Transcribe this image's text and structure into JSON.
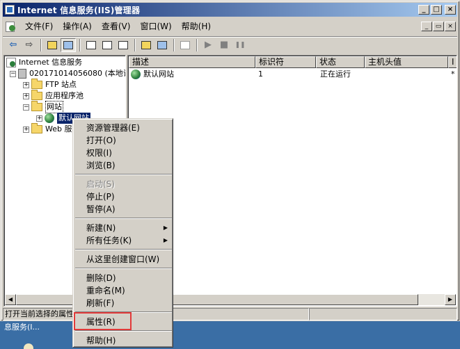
{
  "window": {
    "title": "Internet 信息服务(IIS)管理器",
    "caption_buttons": [
      "_",
      "□",
      "×"
    ]
  },
  "menubar": {
    "items": [
      "文件(F)",
      "操作(A)",
      "查看(V)",
      "窗口(W)",
      "帮助(H)"
    ],
    "mdi_buttons": [
      "_",
      "▭",
      "×"
    ]
  },
  "toolbar": {
    "back_icon": "arrow-left-icon",
    "forward_icon": "arrow-right-icon",
    "play": "▶",
    "stop": "■",
    "pause": "❚❚"
  },
  "tree": {
    "root": "Internet 信息服务",
    "server": "020171014056080 (本地计",
    "ftp": "FTP 站点",
    "app_pools": "应用程序池",
    "websites": "网站",
    "default_site": "默认网站",
    "web_service": "Web 服"
  },
  "list": {
    "columns": [
      "描述",
      "标识符",
      "状态",
      "主机头值",
      "I"
    ],
    "rows": [
      {
        "name": "默认网站",
        "id": "1",
        "state": "正在运行",
        "host": "",
        "ip": "*"
      }
    ]
  },
  "status": {
    "text": "打开当前选择的属性"
  },
  "desktop": {
    "text": "息服务(I..."
  },
  "context_menu": {
    "items": {
      "explorer": "资源管理器(E)",
      "open": "打开(O)",
      "permissions": "权限(I)",
      "browse": "浏览(B)",
      "start": "启动(S)",
      "stop": "停止(P)",
      "pause": "暂停(A)",
      "new": "新建(N)",
      "all_tasks": "所有任务(K)",
      "new_window": "从这里创建窗口(W)",
      "delete": "删除(D)",
      "rename": "重命名(M)",
      "refresh": "刷新(F)",
      "properties": "属性(R)",
      "help": "帮助(H)"
    },
    "submenu_arrow": "▶"
  },
  "colors": {
    "titlebar_start": "#0a246a",
    "titlebar_end": "#a6caf0",
    "highlight_box": "#e23a3a",
    "desktop": "#3a6ea5"
  }
}
